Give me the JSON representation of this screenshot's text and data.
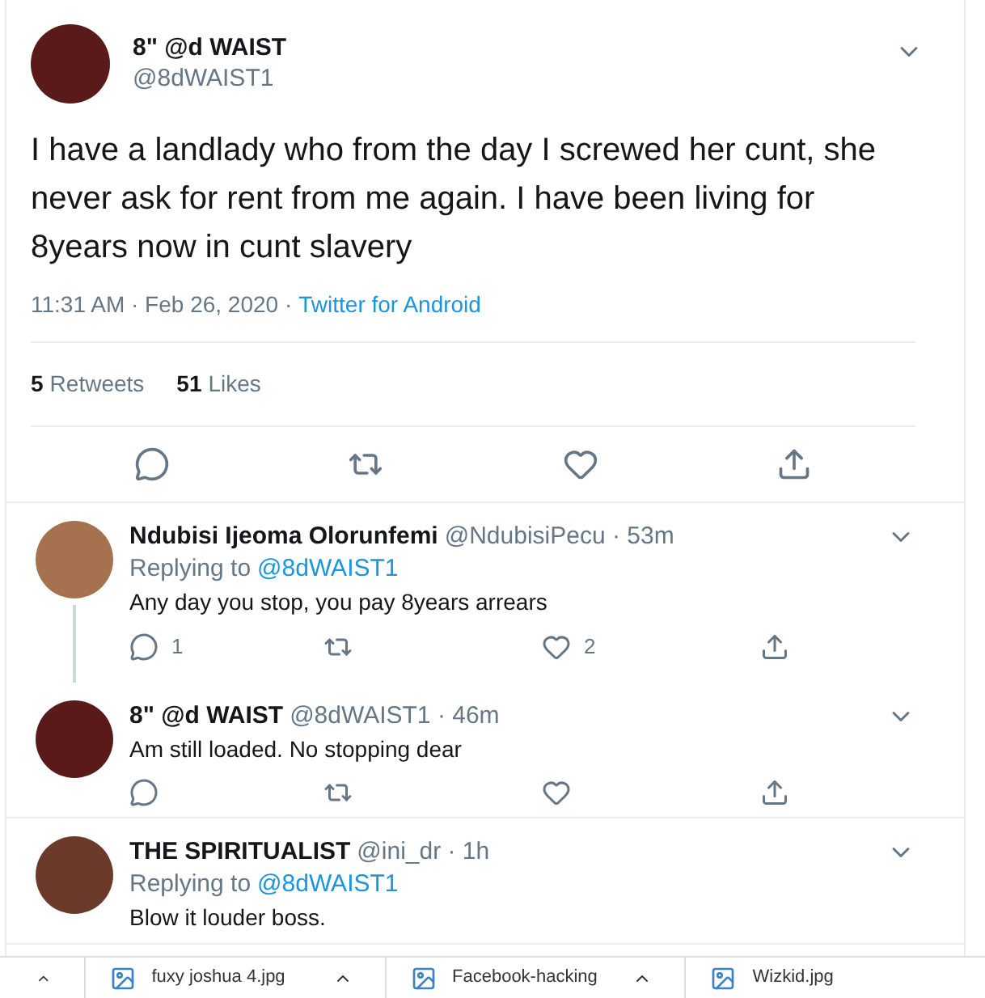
{
  "tweet": {
    "name": "8\" @d WAIST",
    "handle": "@8dWAIST1",
    "text": "I have a landlady who from the day I screwed her cunt, she never ask for rent from me again. I have been living for 8years now in cunt slavery",
    "timestamp": "11:31 AM · Feb 26, 2020 ·",
    "source": "Twitter for Android",
    "stats": [
      {
        "count": "5",
        "label": "Retweets"
      },
      {
        "count": "51",
        "label": "Likes"
      }
    ]
  },
  "replies": [
    {
      "name": "Ndubisi Ijeoma Olorunfemi",
      "meta": "@NdubisiPecu · 53m",
      "replying_label": "Replying to",
      "replying_to": "@8dWAIST1",
      "text": "Any day you stop, you pay 8years arrears",
      "reply_count": "1",
      "like_count": "2",
      "threaded": true,
      "actions": true
    },
    {
      "name": "8\" @d WAIST",
      "meta": "@8dWAIST1 · 46m",
      "text": "Am still loaded. No stopping dear",
      "threaded": false,
      "actions": true
    },
    {
      "name": "THE SPIRITUALIST",
      "meta": "@ini_dr · 1h",
      "replying_label": "Replying to",
      "replying_to": "@8dWAIST1",
      "text": "Blow it louder boss.",
      "threaded": false,
      "actions": false
    }
  ],
  "downloads": [
    {
      "name": "fuxy joshua 4.jpg"
    },
    {
      "name": "Facebook-hacking"
    },
    {
      "name": "Wizkid.jpg"
    }
  ]
}
